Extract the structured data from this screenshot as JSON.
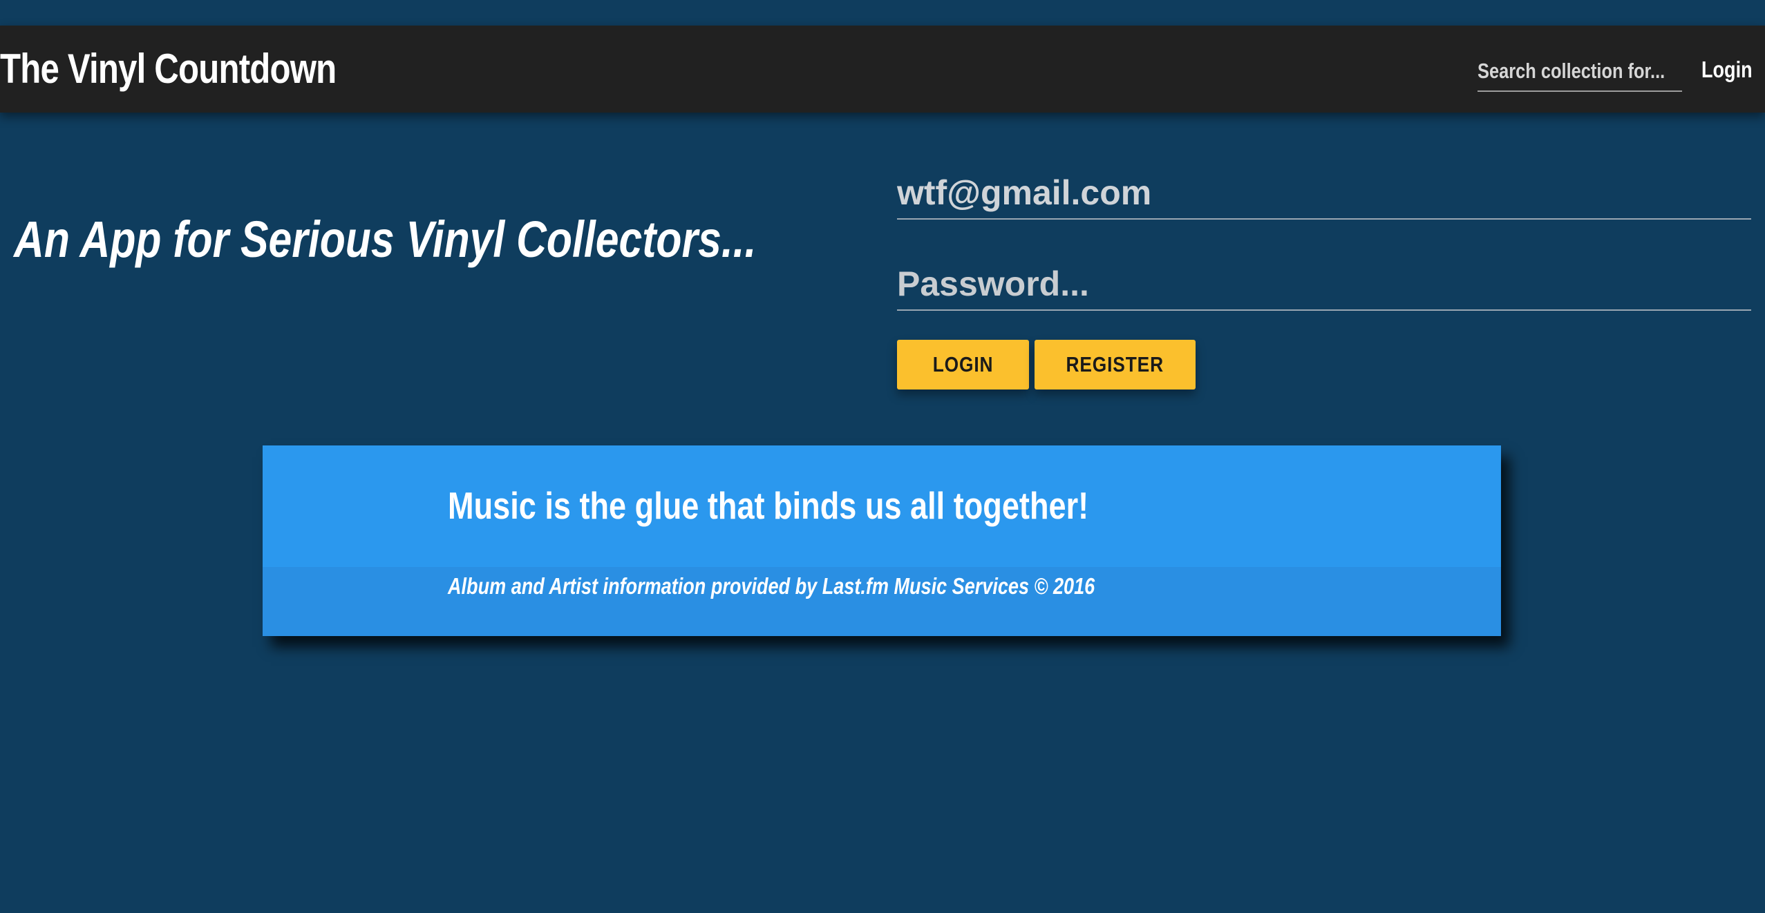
{
  "navbar": {
    "brand": "The Vinyl Countdown",
    "search_placeholder": "Search collection for...",
    "login_label": "Login"
  },
  "hero": {
    "tagline": "An App for Serious Vinyl Collectors..."
  },
  "login_form": {
    "email_value": "wtf@gmail.com",
    "password_placeholder": "Password...",
    "login_button": "LOGIN",
    "register_button": "REGISTER"
  },
  "footer_card": {
    "title": "Music is the glue that binds us all together!",
    "credit": "Album and Artist information provided by Last.fm Music Services © 2016"
  },
  "colors": {
    "background": "#0f3d5e",
    "navbar": "#212121",
    "accent_button": "#fbc02d",
    "card": "#2b98ee"
  }
}
